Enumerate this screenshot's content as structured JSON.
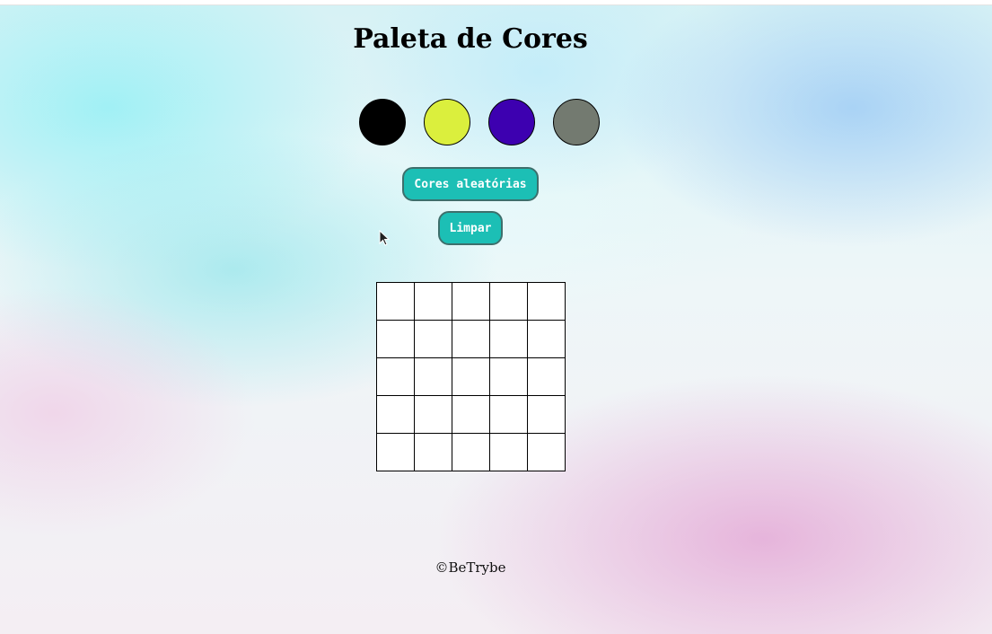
{
  "page": {
    "title": "Paleta de Cores"
  },
  "palette": {
    "colors": [
      "#000000",
      "#dbef3d",
      "#3d00b0",
      "#737a70"
    ]
  },
  "buttons": {
    "random_label": "Cores aleatórias",
    "clear_label": "Limpar"
  },
  "board": {
    "rows": 5,
    "cols": 5,
    "pixel_color": "#ffffff"
  },
  "footer": {
    "text": "©BeTrybe"
  }
}
